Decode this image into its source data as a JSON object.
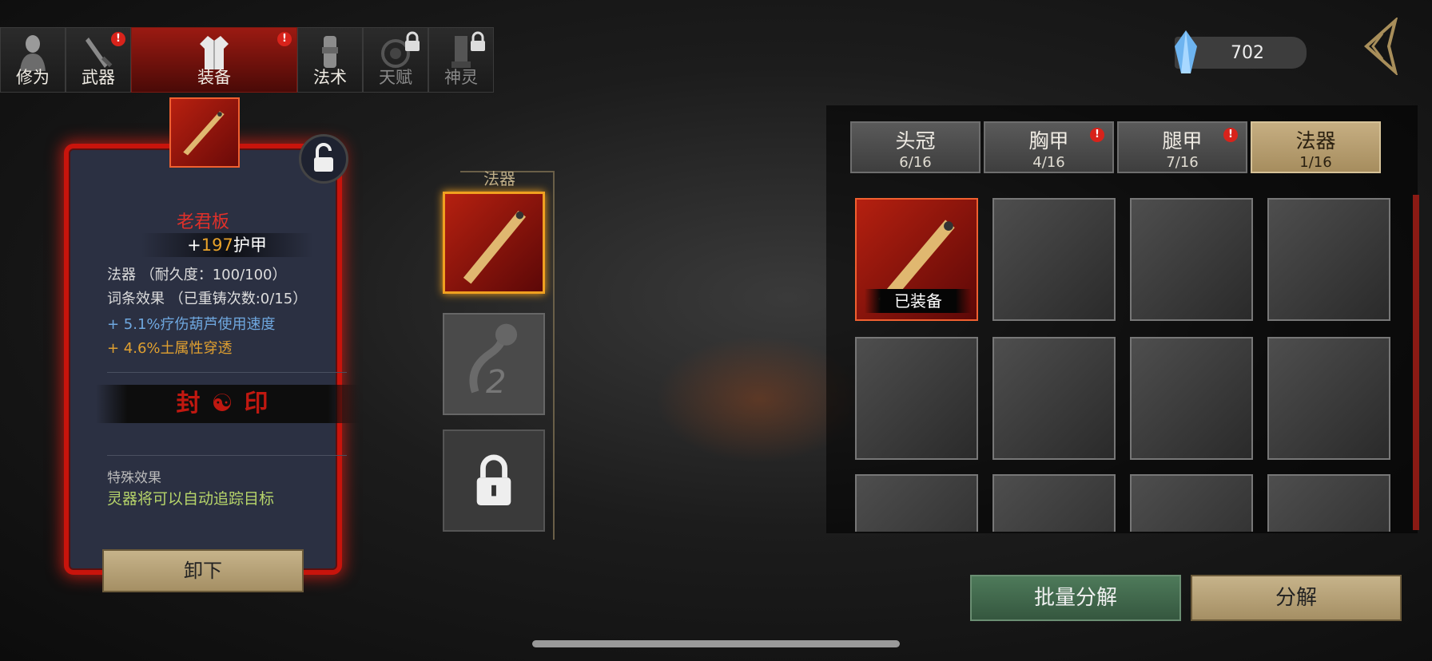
{
  "top_tabs": [
    {
      "label": "修为",
      "icon": "cultivator-icon",
      "badge": "",
      "locked": false
    },
    {
      "label": "武器",
      "icon": "sword-icon",
      "badge": "!",
      "locked": false
    },
    {
      "label": "装备",
      "icon": "robe-icon",
      "badge": "!",
      "locked": false,
      "active": true
    },
    {
      "label": "法术",
      "icon": "scroll-icon",
      "badge": "",
      "locked": false
    },
    {
      "label": "天赋",
      "icon": "bagua-icon",
      "badge": "",
      "locked": true
    },
    {
      "label": "神灵",
      "icon": "tablet-icon",
      "badge": "",
      "locked": true
    }
  ],
  "currency": {
    "value": "702",
    "icon": "crystal-icon"
  },
  "item": {
    "name": "老君板",
    "armor_prefix": "+",
    "armor_value": "197",
    "armor_label": "护甲",
    "type_line": "法器 （耐久度：100/100）",
    "affix_line": "词条效果 （已重铸次数:0/15）",
    "affix1": "+ 5.1%疗伤葫芦使用速度",
    "affix2": "+ 4.6%土属性穿透",
    "seal_text": "封☯印",
    "special_label": "特殊效果",
    "special_text": "灵器将可以自动追踪目标",
    "unequip_label": "卸下"
  },
  "slots": {
    "title": "法器",
    "slot2_number": "2"
  },
  "categories": [
    {
      "name": "头冠",
      "count": "6/16",
      "badge": ""
    },
    {
      "name": "胸甲",
      "count": "4/16",
      "badge": "!"
    },
    {
      "name": "腿甲",
      "count": "7/16",
      "badge": "!"
    },
    {
      "name": "法器",
      "count": "1/16",
      "badge": "",
      "active": true
    }
  ],
  "inventory": {
    "equipped_tag": "已装备"
  },
  "buttons": {
    "bulk": "批量分解",
    "decompose": "分解"
  },
  "colors": {
    "accent_red": "#c8140c",
    "gold": "#c6b38a",
    "green_btn": "#4e7a5a",
    "affix_blue": "#6fa8e0",
    "affix_orange": "#e0a030",
    "special_green": "#b6d46a"
  }
}
